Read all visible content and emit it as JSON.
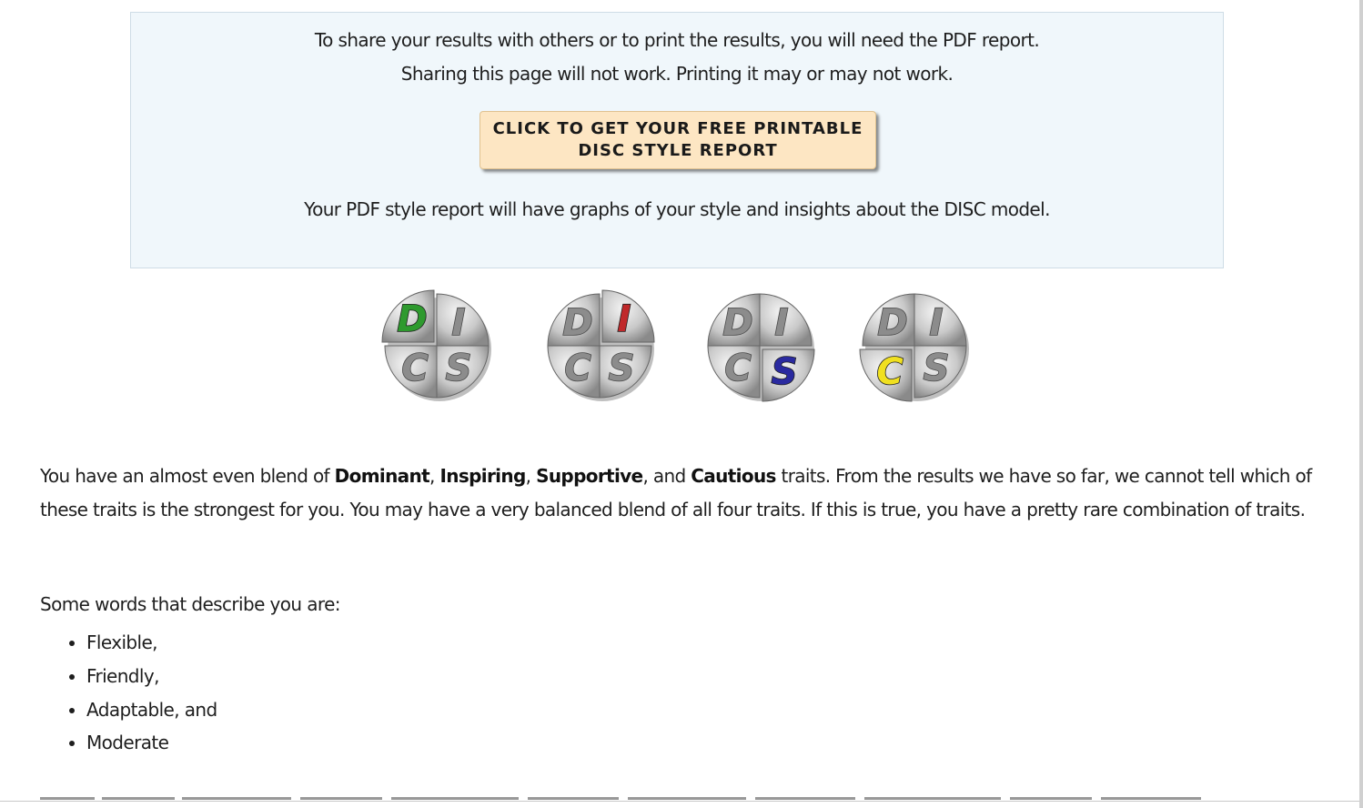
{
  "notice": {
    "line1": "To share your results with others or to print the results, you will need the PDF report.",
    "line2": "Sharing this page will not work. Printing it may or may not work.",
    "button_line1": "CLICK TO GET YOUR FREE PRINTABLE",
    "button_line2": "DISC STYLE REPORT",
    "line3": "Your PDF style report will have graphs of your style and insights about the DISC model."
  },
  "disc_icons": [
    {
      "letters": [
        "D",
        "I",
        "C",
        "S"
      ],
      "highlight": "D",
      "highlight_color": "#2e9a2e"
    },
    {
      "letters": [
        "D",
        "I",
        "C",
        "S"
      ],
      "highlight": "I",
      "highlight_color": "#c0282a"
    },
    {
      "letters": [
        "D",
        "I",
        "C",
        "S"
      ],
      "highlight": "S",
      "highlight_color": "#2a2aa0"
    },
    {
      "letters": [
        "D",
        "I",
        "C",
        "S"
      ],
      "highlight": "C",
      "highlight_color": "#f0e020"
    }
  ],
  "result": {
    "p1": "You have an almost even blend of ",
    "dominant": "Dominant",
    "comma1": ", ",
    "inspiring": "Inspiring",
    "comma2": ", ",
    "supportive": "Supportive",
    "and": ", and ",
    "cautious": "Cautious",
    "p2": " traits. From the results we have so far, we cannot tell which of these traits is the strongest for you. You may have a very balanced blend of all four traits. If this is true, you have a pretty rare combination of traits."
  },
  "words": {
    "intro": "Some words that describe you are:",
    "items": [
      "Flexible,",
      "Friendly,",
      "Adaptable, and",
      "Moderate"
    ]
  },
  "colors": {
    "notice_bg": "#f0f7fb",
    "button_bg": "#fde6c3",
    "icon_gray": "#bdbdbd"
  }
}
